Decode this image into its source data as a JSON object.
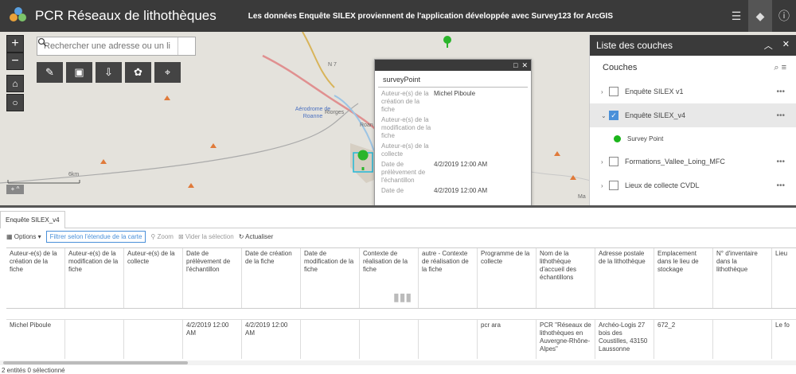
{
  "header": {
    "title": "PCR Réseaux de lithothèques",
    "subtitle": "Les données Enquête SILEX proviennent de l'application développée avec Survey123 for ArcGIS",
    "icons": [
      "list-icon",
      "layers-icon",
      "info-icon"
    ]
  },
  "map": {
    "search_placeholder": "Rechercher une adresse ou un li",
    "labels": {
      "road": "N 7",
      "airport": "Aérodrome de Roanne",
      "town": "Riorges",
      "town2": "Roan",
      "scale": "6km",
      "corner": "Ma"
    }
  },
  "popup": {
    "title": "surveyPoint",
    "rows": [
      {
        "key": "Auteur-e(s) de la création de la fiche",
        "value": "Michel Piboule"
      },
      {
        "key": "Auteur-e(s) de la modification de la fiche",
        "value": ""
      },
      {
        "key": "Auteur-e(s) de la collecte",
        "value": ""
      },
      {
        "key": "Date de prélèvement de l'échantillon",
        "value": "4/2/2019 12:00 AM"
      },
      {
        "key": "Date de",
        "value": "4/2/2019 12:00 AM"
      }
    ]
  },
  "layers": {
    "title": "Liste des couches",
    "section": "Couches",
    "items": [
      {
        "label": "Enquête SILEX v1",
        "checked": false
      },
      {
        "label": "Enquête SILEX_v4",
        "checked": true
      },
      {
        "label": "Survey Point",
        "sub": true
      },
      {
        "label": "Formations_Vallee_Loing_MFC",
        "checked": false
      },
      {
        "label": "Lieux de collecte CVDL",
        "checked": false
      }
    ]
  },
  "table": {
    "tab": "Enquête SILEX_v4",
    "toolbar": {
      "options": "Options",
      "filter": "Filtrer selon l'étendue de la carte",
      "zoom": "Zoom",
      "clear": "Vider la sélection",
      "refresh": "Actualiser"
    },
    "columns": [
      "Auteur-e(s) de la création de la fiche",
      "Auteur-e(s) de la modification de la fiche",
      "Auteur-e(s) de la collecte",
      "Date de prélèvement de l'échantillon",
      "Date de création de la fiche",
      "Date de modification de la fiche",
      "Contexte de réalisation de la fiche",
      "autre - Contexte de réalisation de la fiche",
      "Programme de la collecte",
      "Nom de la lithothèque d'accueil des échantillons",
      "Adresse postale de la lithothèque",
      "Emplacement dans le lieu de stockage",
      "N° d'inventaire dans la lithothèque",
      "Lieu"
    ],
    "rows": [
      [
        "Michel Piboule",
        "",
        "",
        "4/2/2019 12:00 AM",
        "4/2/2019 12:00 AM",
        "",
        "",
        "",
        "pcr ara",
        "PCR \"Réseaux de lithothèques en Auvergne-Rhône-Alpes\"",
        "Archéo-Logis 27 bois des Coustilles, 43150 Laussonne",
        "672_2",
        "",
        "Le fo"
      ]
    ],
    "status": "2 entités 0 sélectionné"
  }
}
